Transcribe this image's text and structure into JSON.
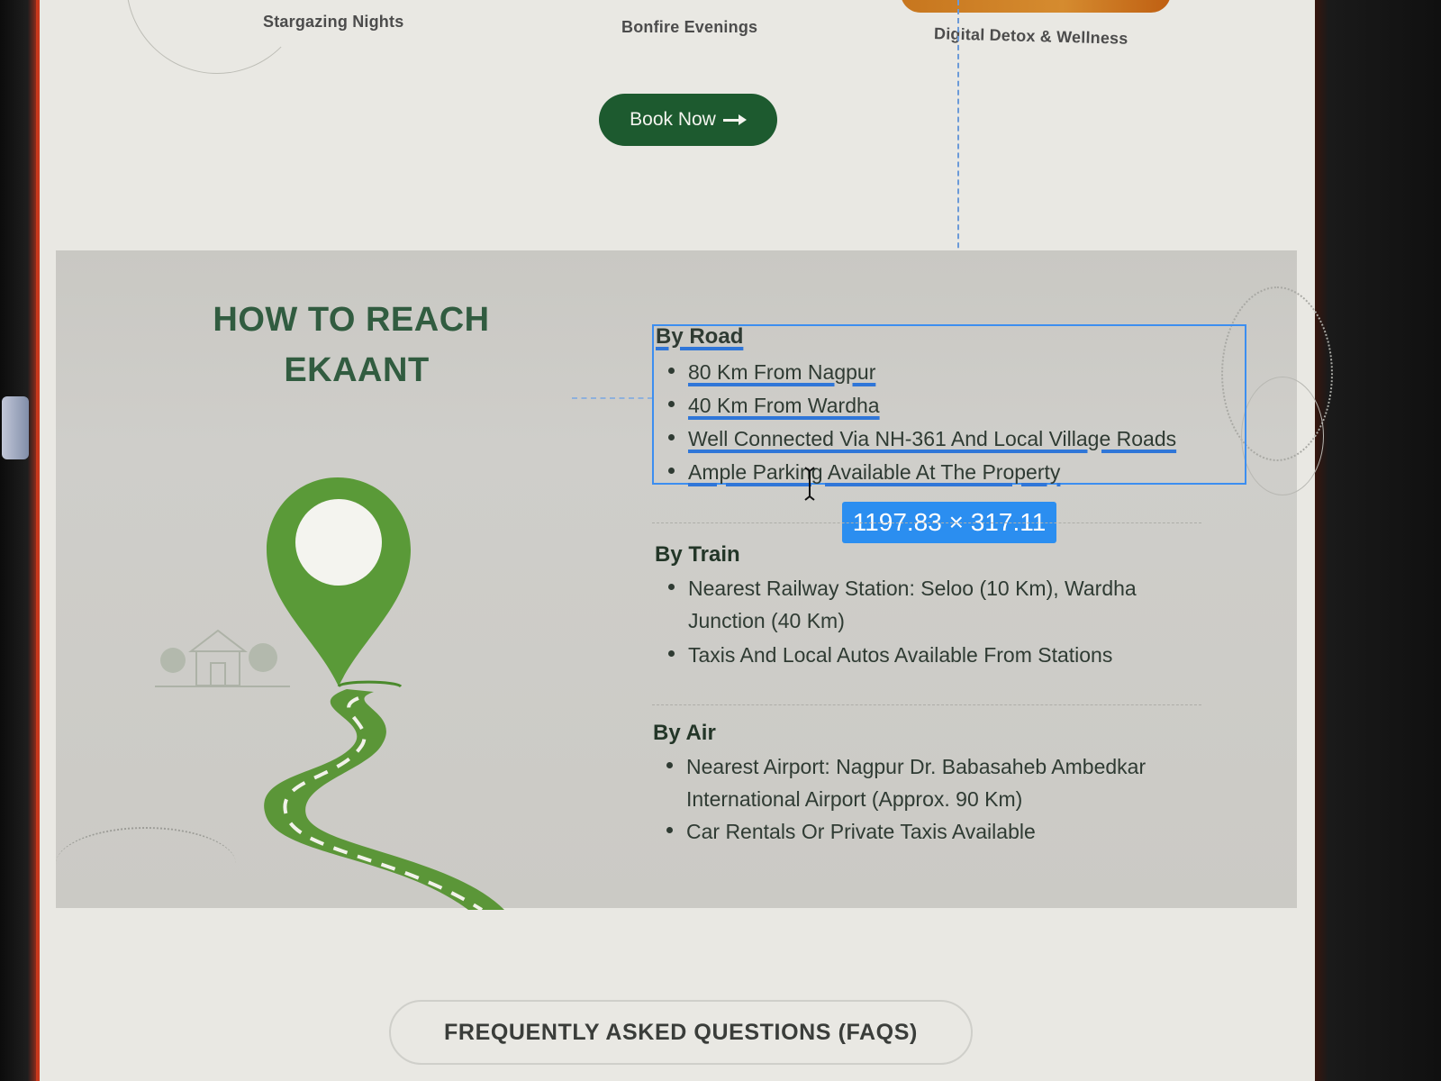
{
  "activities": [
    "Stargazing Nights",
    "Bonfire Evenings",
    "Digital Detox & Wellness"
  ],
  "book_button": "Book Now",
  "section": {
    "title_line1": "HOW TO REACH",
    "title_line2": "EKAANT"
  },
  "by_road": {
    "heading": "By Road",
    "items": [
      "80 Km From Nagpur",
      "40 Km From Wardha",
      "Well Connected Via NH-361 And Local Village Roads",
      "Ample Parking Available At The Property"
    ]
  },
  "selection_dimensions": "1197.83 × 317.11",
  "by_train": {
    "heading": "By Train",
    "items": [
      {
        "line1": "Nearest Railway Station: Seloo (10 Km), Wardha",
        "line2": "Junction (40 Km)"
      },
      {
        "line1": "Taxis And Local Autos Available From Stations"
      }
    ]
  },
  "by_air": {
    "heading": "By Air",
    "items": [
      {
        "line1": "Nearest Airport: Nagpur Dr. Babasaheb Ambedkar",
        "line2": "International Airport (Approx. 90 Km)"
      },
      {
        "line1": "Car Rentals Or Private Taxis Available"
      }
    ]
  },
  "faq_button": "FREQUENTLY ASKED QUESTIONS (FAQS)",
  "colors": {
    "accent_green": "#1d5a2f",
    "title_green": "#315c40",
    "pin_green": "#5a9a38",
    "selection_blue": "#3c8ef0"
  },
  "icons": [
    "arrow-right-icon",
    "location-pin-icon",
    "road-icon",
    "text-cursor-icon",
    "farmhouse-icon"
  ]
}
